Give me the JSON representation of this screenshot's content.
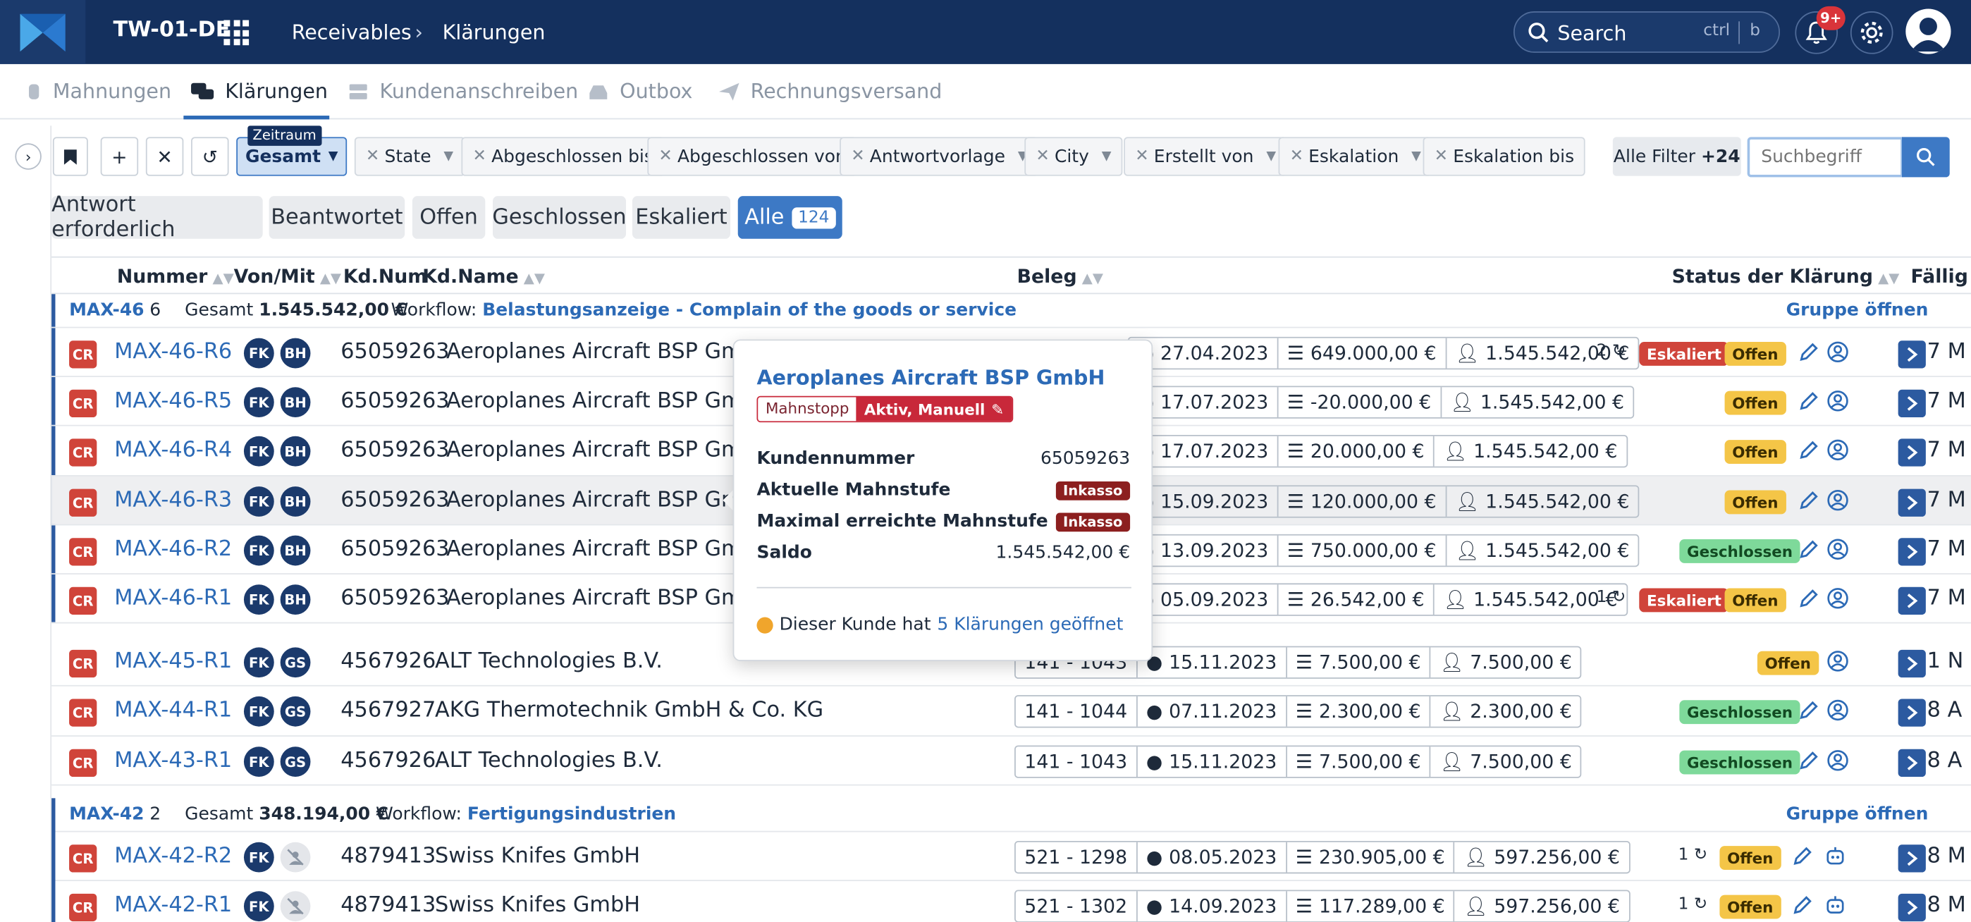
{
  "topbar": {
    "tenant": "TW-01-DE",
    "breadcrumb": [
      "Receivables",
      "Klärungen"
    ],
    "search_label": "Search",
    "search_kbd": [
      "ctrl",
      "b"
    ],
    "notif_count": "9+"
  },
  "subnav": {
    "tabs": [
      {
        "label": "Mahnungen",
        "icon": "hand-icon"
      },
      {
        "label": "Klärungen",
        "icon": "chat-icon",
        "active": true
      },
      {
        "label": "Kundenanschreiben",
        "icon": "stack-icon"
      },
      {
        "label": "Outbox",
        "icon": "tray-icon"
      },
      {
        "label": "Rechnungsversand",
        "icon": "paper-plane-icon"
      }
    ]
  },
  "filters": {
    "zeitraum_label": "Zeitraum",
    "gesamt_label": "Gesamt",
    "chips": [
      "State",
      "Abgeschlossen bis",
      "Abgeschlossen von",
      "Antwortvorlage",
      "City",
      "Erstellt von",
      "Eskalation",
      "Eskalation bis"
    ],
    "all_filter_label": "Alle Filter",
    "all_filter_count": "+24",
    "search_placeholder": "Suchbegriff"
  },
  "status_tabs": {
    "items": [
      "Antwort erforderlich",
      "Beantwortet",
      "Offen",
      "Geschlossen",
      "Eskaliert"
    ],
    "all_label": "Alle",
    "all_count": "124"
  },
  "table": {
    "headers": {
      "nummer": "Nummer",
      "vonmit": "Von/Mit",
      "kdnum": "Kd.Num",
      "kdname": "Kd.Name",
      "beleg": "Beleg",
      "status": "Status der Klärung",
      "faellig": "Fällig"
    },
    "group_total_label": "Gesamt",
    "workflow_label": "Workflow:",
    "group_open_label": "Gruppe öffnen",
    "groups": [
      {
        "id": "MAX-46",
        "count": "6",
        "total": "1.545.542,00 €",
        "workflow": "Belastungsanzeige - Complain of the goods or service"
      },
      {
        "id": "MAX-42",
        "count": "2",
        "total": "348.194,00 €",
        "workflow": "Fertigungsindustrien"
      }
    ],
    "rows": [
      {
        "type": "CR",
        "num": "MAX-46-R6",
        "von": "FK",
        "mit": "BH",
        "kdnum": "65059263",
        "kdname": "Aeroplanes Aircraft BSP GmbH",
        "date": "27.04.2023",
        "amount": "649.000,00 €",
        "saldo": "1.545.542,00 €",
        "cnt": "2",
        "escalated": "Eskaliert",
        "status": "Offen",
        "rest": "7 M"
      },
      {
        "type": "CR",
        "num": "MAX-46-R5",
        "von": "FK",
        "mit": "BH",
        "kdnum": "65059263",
        "kdname": "Aeroplanes Aircraft BSP GmbH",
        "date": "17.07.2023",
        "amount": "-20.000,00 €",
        "saldo": "1.545.542,00 €",
        "status": "Offen",
        "rest": "7 M"
      },
      {
        "type": "CR",
        "num": "MAX-46-R4",
        "von": "FK",
        "mit": "BH",
        "kdnum": "65059263",
        "kdname": "Aeroplanes Aircraft BSP GmbH",
        "date": "17.07.2023",
        "amount": "20.000,00 €",
        "saldo": "1.545.542,00 €",
        "status": "Offen",
        "rest": "7 M"
      },
      {
        "type": "CR",
        "num": "MAX-46-R3",
        "von": "FK",
        "mit": "BH",
        "kdnum": "65059263",
        "kdname": "Aeroplanes Aircraft BSP GmbH",
        "date": "15.09.2023",
        "amount": "120.000,00 €",
        "saldo": "1.545.542,00 €",
        "status": "Offen",
        "rest": "7 M"
      },
      {
        "type": "CR",
        "num": "MAX-46-R2",
        "von": "FK",
        "mit": "BH",
        "kdnum": "65059263",
        "kdname": "Aeroplanes Aircraft BSP GmbH",
        "date": "13.09.2023",
        "amount": "750.000,00 €",
        "saldo": "1.545.542,00 €",
        "status": "Geschlossen",
        "rest": "7 M"
      },
      {
        "type": "CR",
        "num": "MAX-46-R1",
        "von": "FK",
        "mit": "BH",
        "kdnum": "65059263",
        "kdname": "Aeroplanes Aircraft BSP GmbH",
        "date": "05.09.2023",
        "amount": "26.542,00 €",
        "saldo": "1.545.542,00 €",
        "cnt": "1",
        "escalated": "Eskaliert",
        "status": "Offen",
        "rest": "7 M"
      },
      {
        "type": "CR",
        "num": "MAX-45-R1",
        "von": "FK",
        "mit": "GS",
        "kdnum": "4567926",
        "kdname": "ALT Technologies B.V.",
        "beleg": "141 - 1043",
        "date": "15.11.2023",
        "amount": "7.500,00 €",
        "saldo": "7.500,00 €",
        "status": "Offen",
        "rest": "1 N"
      },
      {
        "type": "CR",
        "num": "MAX-44-R1",
        "von": "FK",
        "mit": "GS",
        "kdnum": "4567927",
        "kdname": "AKG Thermotechnik GmbH & Co. KG",
        "beleg": "141 - 1044",
        "date": "07.11.2023",
        "amount": "2.300,00 €",
        "saldo": "2.300,00 €",
        "status": "Geschlossen",
        "rest": "8 A"
      },
      {
        "type": "CR",
        "num": "MAX-43-R1",
        "von": "FK",
        "mit": "GS",
        "kdnum": "4567926",
        "kdname": "ALT Technologies B.V.",
        "beleg": "141 - 1043",
        "date": "15.11.2023",
        "amount": "7.500,00 €",
        "saldo": "7.500,00 €",
        "status": "Geschlossen",
        "rest": "8 A"
      },
      {
        "type": "CR",
        "num": "MAX-42-R2",
        "von": "FK",
        "kdnum": "4879413",
        "kdname": "Swiss Knifes GmbH",
        "beleg": "521 - 1298",
        "date": "08.05.2023",
        "amount": "230.905,00 €",
        "saldo": "597.256,00 €",
        "cnt": "1",
        "status": "Offen",
        "rest": "8 M"
      },
      {
        "type": "CR",
        "num": "MAX-42-R1",
        "von": "FK",
        "kdnum": "4879413",
        "kdname": "Swiss Knifes GmbH",
        "beleg": "521 - 1302",
        "date": "14.09.2023",
        "amount": "117.289,00 €",
        "saldo": "597.256,00 €",
        "cnt": "1",
        "status": "Offen",
        "rest": "8 M"
      }
    ]
  },
  "popup": {
    "title": "Aeroplanes Aircraft BSP GmbH",
    "mahnstopp": "Mahnstopp",
    "mahnstopp_value": "Aktiv, Manuell",
    "kundennummer_label": "Kundennummer",
    "kundennummer": "65059263",
    "aktuelle_label": "Aktuelle Mahnstufe",
    "aktuelle": "Inkasso",
    "maximal_label": "Maximal erreichte Mahnstufe",
    "maximal": "Inkasso",
    "saldo_label": "Saldo",
    "saldo": "1.545.542,00 €",
    "footer_text": "Dieser Kunde hat",
    "footer_link": "5 Klärungen geöffnet"
  },
  "colors": {
    "navy": "#14305e",
    "accent": "#2c6ab6",
    "danger": "#d0443a",
    "warning": "#f4c547",
    "success": "#7ed99a"
  }
}
